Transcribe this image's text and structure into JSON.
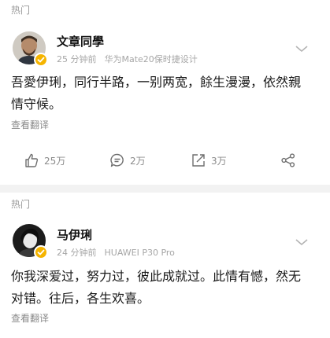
{
  "section1": {
    "label": "热门"
  },
  "post1": {
    "username": "文章同學",
    "time": "25 分钟前",
    "device": "华为Mate20保时捷设计",
    "content_line1": "吾愛伊琍，同行半路，一别两宽，餘生漫漫，依然親",
    "content_line2": "情守候。",
    "translate": "查看翻译",
    "likes": "25万",
    "comments": "2万",
    "reposts": "3万"
  },
  "section2": {
    "label": "热门"
  },
  "post2": {
    "username": "马伊琍",
    "time": "24 分钟前",
    "device": "HUAWEI P30 Pro",
    "content_line1": "你我深爱过，努力过，彼此成就过。此情有憾，然无",
    "content_line2": "对错。往后，各生欢喜。",
    "translate": "查看翻译"
  },
  "colors": {
    "badge": "#f5b400",
    "text_secondary": "#8a8a8a",
    "divider": "#f2f2f2"
  }
}
